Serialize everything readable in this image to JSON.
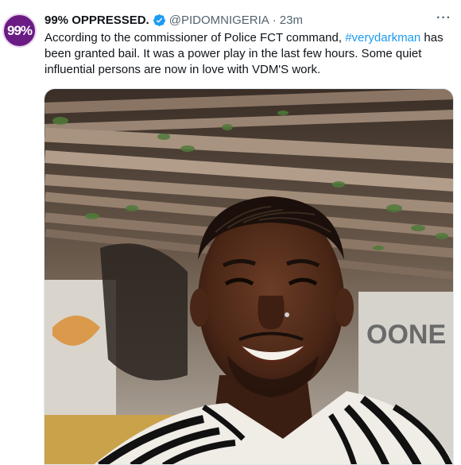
{
  "tweet": {
    "avatar_text": "99%",
    "display_name": "99% OPPRESSED.",
    "handle": "@PIDOMNIGERIA",
    "separator": "·",
    "time": "23m",
    "more_label": "···",
    "text_before": "According to the commissioner of Police FCT command, ",
    "hashtag": "#verydarkman",
    "text_after": " has been granted bail. It was a power play in the last few hours. Some quiet influential persons are now in love with VDM'S work.",
    "background_sign_text": "OONE",
    "colors": {
      "hashtag": "#1d9bf0",
      "verified_badge": "#1d9bf0",
      "avatar_bg": "#6a1b84"
    },
    "icons": {
      "verified": "verified-badge-icon",
      "more": "more-options-icon"
    }
  }
}
